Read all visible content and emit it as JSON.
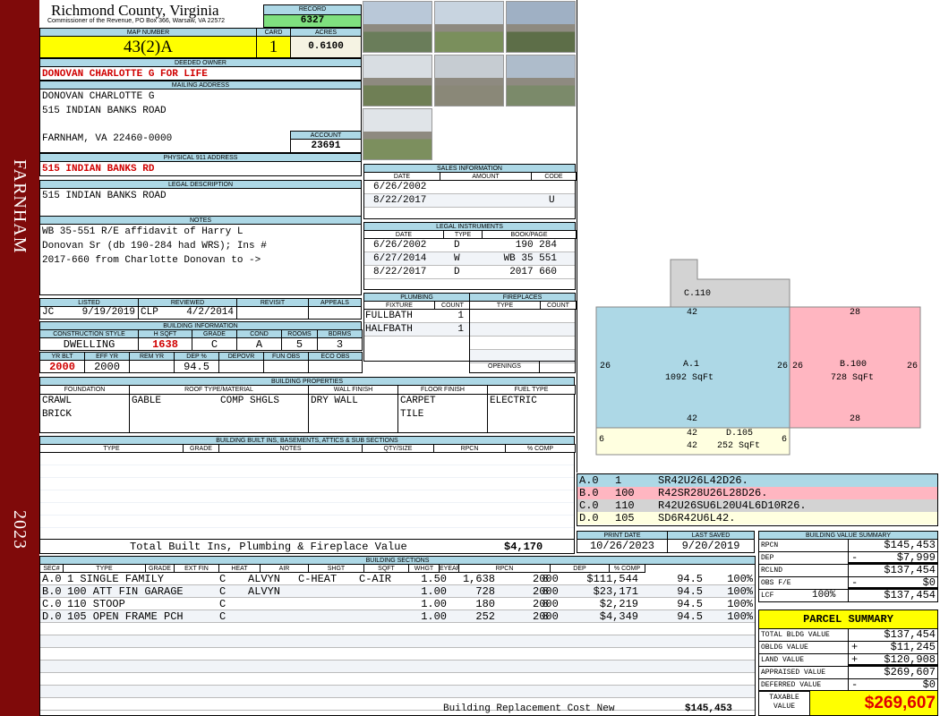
{
  "sidebar": {
    "city": "FARNHAM",
    "year": "2023"
  },
  "header": {
    "title": "Richmond County, Virginia",
    "subtitle": "Commissioner of the Revenue, PO Box 366, Warsaw, VA 22572",
    "record_label": "RECORD",
    "record": "6327"
  },
  "parcel": {
    "map_label": "MAP NUMBER",
    "map": "43(2)A",
    "card_label": "CARD",
    "card": "1",
    "acres_label": "ACRES",
    "acres": "0.6100"
  },
  "owner": {
    "label": "DEEDED OWNER",
    "name": "DONOVAN CHARLOTTE G FOR LIFE"
  },
  "mailing": {
    "label": "MAILING ADDRESS",
    "lines": [
      "DONOVAN CHARLOTTE G",
      "515 INDIAN BANKS ROAD",
      "FARNHAM, VA 22460-0000"
    ],
    "account_label": "ACCOUNT",
    "account": "23691"
  },
  "physical": {
    "label": "PHYSICAL 911 ADDRESS",
    "value": "515 INDIAN BANKS RD"
  },
  "legal": {
    "label": "LEGAL DESCRIPTION",
    "value": "515 INDIAN BANKS ROAD"
  },
  "notes": {
    "label": "NOTES",
    "lines": [
      "WB 35-551 R/E affidavit of Harry L",
      "Donovan Sr (db 190-284 had WRS); Ins #",
      "2017-660 from Charlotte Donovan to ->"
    ]
  },
  "review": {
    "listed_label": "LISTED",
    "listed_by": "JC",
    "listed_date": "9/19/2019",
    "reviewed_label": "REVIEWED",
    "reviewed_by": "CLP",
    "reviewed_date": "4/2/2014",
    "revisit_label": "REVISIT",
    "appeals_label": "APPEALS"
  },
  "building_info": {
    "title": "BUILDING INFORMATION",
    "headers1": [
      "CONSTRUCTION STYLE",
      "H SQFT",
      "GRADE",
      "COND",
      "ROOMS",
      "BDRMS"
    ],
    "values1": [
      "DWELLING",
      "1638",
      "C",
      "A",
      "5",
      "3"
    ],
    "headers2": [
      "YR BLT",
      "EFF YR",
      "REM YR",
      "DEP %",
      "DEPOVR",
      "FUN OBS",
      "ECO OBS"
    ],
    "values2": [
      "2000",
      "2000",
      "",
      "94.5",
      "",
      "",
      ""
    ]
  },
  "properties": {
    "title": "BUILDING PROPERTIES",
    "headers": [
      "FOUNDATION",
      "ROOF TYPE/MATERIAL",
      "WALL FINISH",
      "FLOOR FINISH",
      "FUEL TYPE"
    ],
    "foundation": [
      "CRAWL",
      "BRICK"
    ],
    "roof_type": "GABLE",
    "roof_material": "COMP SHGLS",
    "wall": "DRY WALL",
    "floor": [
      "CARPET",
      "TILE"
    ],
    "fuel": "ELECTRIC"
  },
  "builtins": {
    "title": "BUILDING BUILT INS, BASEMENTS, ATTICS & SUB SECTIONS",
    "headers": [
      "TYPE",
      "GRADE",
      "NOTES",
      "QTY/SIZE",
      "RPCN",
      "% COMP"
    ],
    "total_label": "Total Built Ins, Plumbing & Fireplace Value",
    "total": "$4,170"
  },
  "sales": {
    "title": "SALES INFORMATION",
    "headers": [
      "DATE",
      "AMOUNT",
      "CODE"
    ],
    "rows": [
      [
        "6/26/2002",
        "",
        ""
      ],
      [
        "8/22/2017",
        "",
        "U"
      ]
    ]
  },
  "instruments": {
    "title": "LEGAL INSTRUMENTS",
    "headers": [
      "DATE",
      "TYPE",
      "BOOK/PAGE"
    ],
    "rows": [
      [
        "6/26/2002",
        "D",
        "190 284"
      ],
      [
        "6/27/2014",
        "W",
        "WB 35 551"
      ],
      [
        "8/22/2017",
        "D",
        "2017 660"
      ]
    ]
  },
  "plumbing": {
    "title": "PLUMBING",
    "headers": [
      "FIXTURE",
      "COUNT"
    ],
    "rows": [
      [
        "FULLBATH",
        "1"
      ],
      [
        "HALFBATH",
        "1"
      ]
    ]
  },
  "fireplaces": {
    "title": "FIREPLACES",
    "headers": [
      "TYPE",
      "COUNT"
    ],
    "openings_label": "OPENINGS"
  },
  "sketch": {
    "labels": {
      "c": "C.110",
      "a": "A.1",
      "a_area": "1092 SqFt",
      "b": "B.100",
      "b_area": "728 SqFt",
      "d": "D.105",
      "d_area": "252 SqFt"
    },
    "dims": {
      "a_top": "42",
      "a_left": "26",
      "a_right": "26",
      "a_bottom": "42",
      "b_top": "28",
      "b_left": "26",
      "b_right": "26",
      "b_bottom": "28",
      "d_top": "42",
      "d_left": "6",
      "d_right": "6",
      "d_bottom": "42"
    },
    "legend": [
      [
        "A.0",
        "1",
        "SR42U26L42D26."
      ],
      [
        "B.0",
        "100",
        "R42SR28U26L28D26."
      ],
      [
        "C.0",
        "110",
        "R42U26SU6L20U4L6D10R26."
      ],
      [
        "D.0",
        "105",
        "SD6R42U6L42."
      ]
    ],
    "colors": {
      "a": "#add8e6",
      "b": "#ffb6c1",
      "c": "#d3d3d3",
      "d": "#ffffe0"
    }
  },
  "dates": {
    "print_label": "PRINT DATE",
    "print": "10/26/2023",
    "saved_label": "LAST SAVED",
    "saved": "9/20/2019"
  },
  "sections": {
    "title": "BUILDING SECTIONS",
    "headers": [
      "SEC#",
      "TYPE",
      "GRADE",
      "EXT FIN",
      "HEAT",
      "AIR",
      "SHGT",
      "SQFT",
      "WHGT",
      "EYEAR",
      "RPCN",
      "DEP",
      "% COMP"
    ],
    "rows": [
      [
        "A.0",
        "1 SINGLE FAMILY",
        "C",
        "ALVYN",
        "C-HEAT",
        "C-AIR",
        "1.50",
        "1,638",
        "8",
        "2000",
        "$111,544",
        "94.5",
        "100%"
      ],
      [
        "B.0",
        "100 ATT FIN GARAGE",
        "C",
        "ALVYN",
        "",
        "",
        "1.00",
        "728",
        "8",
        "2000",
        "$23,171",
        "94.5",
        "100%"
      ],
      [
        "C.0",
        "110 STOOP",
        "C",
        "",
        "",
        "",
        "1.00",
        "180",
        "8",
        "2000",
        "$2,219",
        "94.5",
        "100%"
      ],
      [
        "D.0",
        "105 OPEN FRAME PCH",
        "C",
        "",
        "",
        "",
        "1.00",
        "252",
        "8",
        "2000",
        "$4,349",
        "94.5",
        "100%"
      ]
    ],
    "total_label": "Building Replacement Cost New",
    "total": "$145,453"
  },
  "value_summary": {
    "title": "BUILDING VALUE SUMMARY",
    "rows": [
      [
        "RPCN",
        "",
        "",
        "$145,453"
      ],
      [
        "DEP",
        "",
        "-",
        "$7,999"
      ],
      [
        "RCLND",
        "",
        "",
        "$137,454"
      ],
      [
        "OBS F/E",
        "",
        "-",
        "$0"
      ],
      [
        "LCF",
        "100%",
        "",
        "$137,454"
      ]
    ]
  },
  "parcel_summary": {
    "title": "PARCEL SUMMARY",
    "rows": [
      [
        "TOTAL BLDG VALUE",
        "",
        "$137,454"
      ],
      [
        "OBLDG VALUE",
        "+",
        "$11,245"
      ],
      [
        "LAND VALUE",
        "+",
        "$120,908"
      ],
      [
        "APPRAISED VALUE",
        "",
        "$269,607"
      ],
      [
        "DEFERRED VALUE",
        "-",
        "$0"
      ]
    ],
    "taxable_label": "TAXABLE VALUE",
    "taxable": "$269,607"
  }
}
